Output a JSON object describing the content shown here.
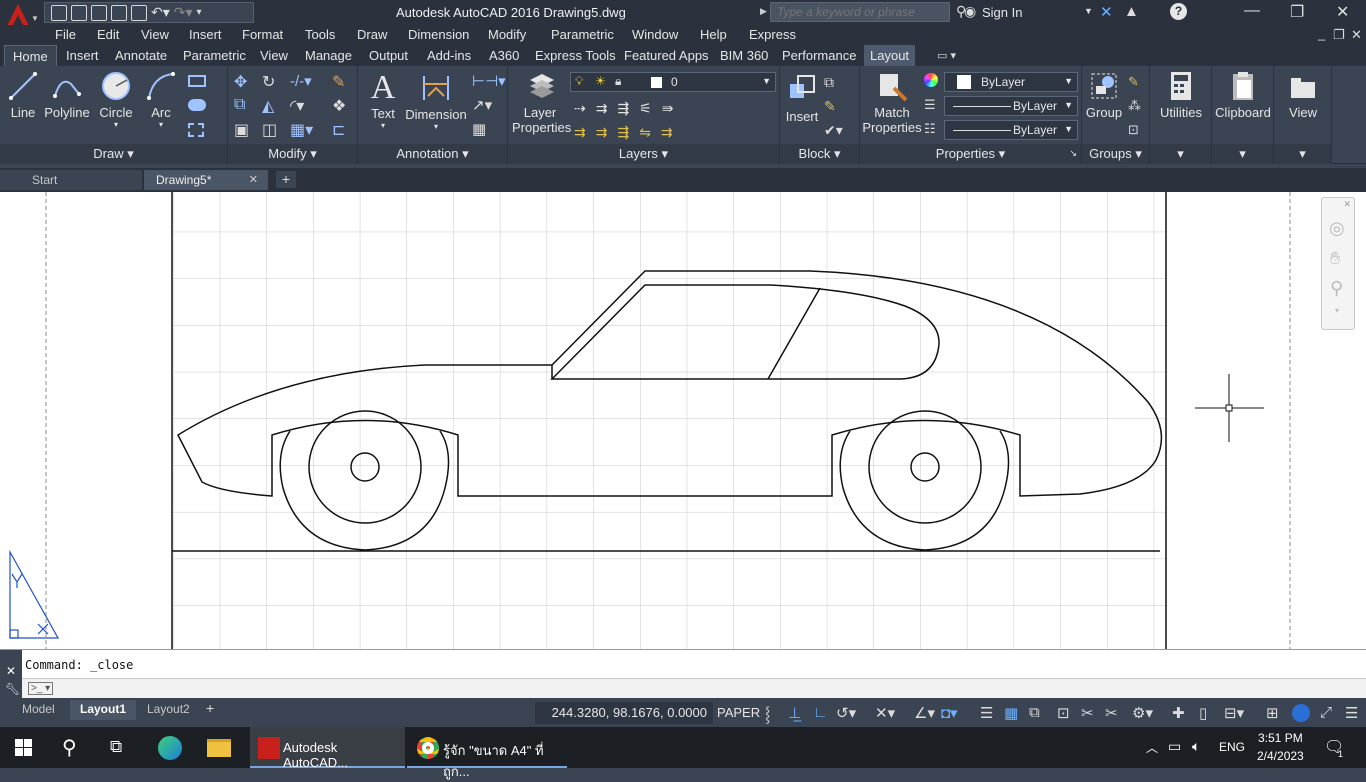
{
  "title_bar": {
    "title": "Autodesk AutoCAD 2016    Drawing5.dwg",
    "search_placeholder": "Type a keyword or phrase",
    "sign_in": "Sign In"
  },
  "menu": [
    "File",
    "Edit",
    "View",
    "Insert",
    "Format",
    "Tools",
    "Draw",
    "Dimension",
    "Modify",
    "Parametric",
    "Window",
    "Help",
    "Express"
  ],
  "ribbon_tabs": [
    "Home",
    "Insert",
    "Annotate",
    "Parametric",
    "View",
    "Manage",
    "Output",
    "Add-ins",
    "A360",
    "Express Tools",
    "Featured Apps",
    "BIM 360",
    "Performance",
    "Layout"
  ],
  "ribbon": {
    "draw": {
      "label": "Draw",
      "line": "Line",
      "polyline": "Polyline",
      "circle": "Circle",
      "arc": "Arc"
    },
    "modify": {
      "label": "Modify"
    },
    "annotation": {
      "label": "Annotation",
      "text": "Text",
      "dimension": "Dimension"
    },
    "layers": {
      "label": "Layers",
      "layer_properties_1": "Layer",
      "layer_properties_2": "Properties",
      "current_layer": "0"
    },
    "block": {
      "label": "Block",
      "insert": "Insert"
    },
    "properties": {
      "label": "Properties",
      "match_1": "Match",
      "match_2": "Properties",
      "color": "ByLayer",
      "linetype": "ByLayer",
      "lineweight": "ByLayer"
    },
    "groups": {
      "label": "Groups",
      "group": "Group"
    },
    "utilities": "Utilities",
    "clipboard": "Clipboard",
    "view": "View"
  },
  "doc_tabs": {
    "start": "Start",
    "current": "Drawing5*"
  },
  "command": {
    "history": "Command:  _close",
    "placeholder": ""
  },
  "layout_tabs": [
    "Model",
    "Layout1",
    "Layout2"
  ],
  "status": {
    "coords": "244.3280, 98.1676, 0.0000",
    "space": "PAPER"
  },
  "taskbar": {
    "app1": "Autodesk AutoCAD...",
    "app2": "รู้จัก \"ขนาด A4\" ที่ถูก...",
    "lang": "ENG",
    "time": "3:51 PM",
    "date": "2/4/2023",
    "notif": "1"
  }
}
